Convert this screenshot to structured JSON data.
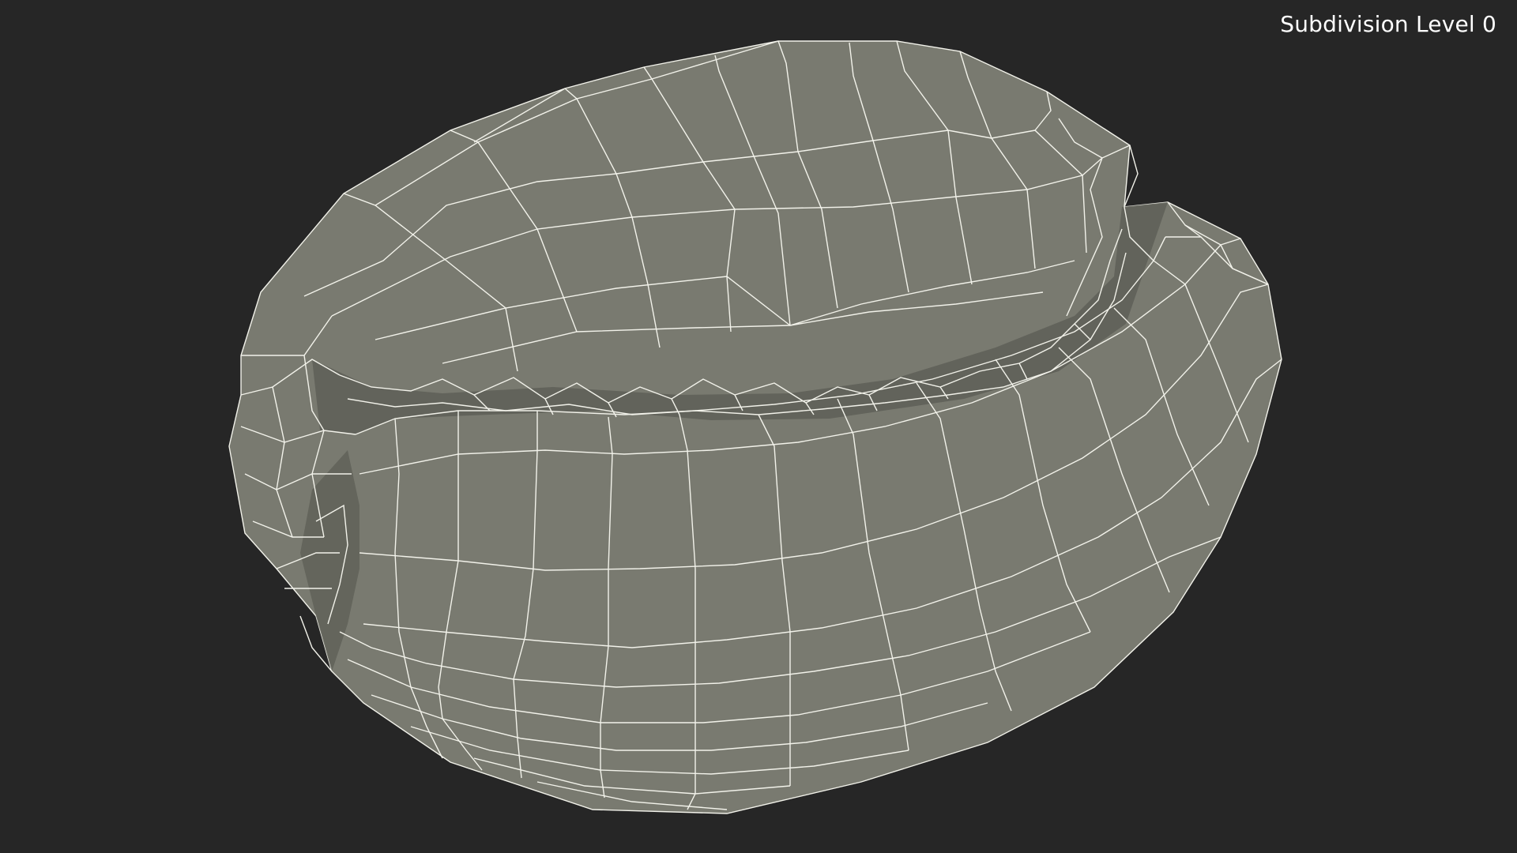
{
  "viewport": {
    "overlay_label": "Subdivision Level 0",
    "background_color": "#262626",
    "surface_color": "#797a70",
    "shadow_color": "#55564f",
    "wire_color": "#f2f2ea",
    "object": "coffee-bean"
  }
}
